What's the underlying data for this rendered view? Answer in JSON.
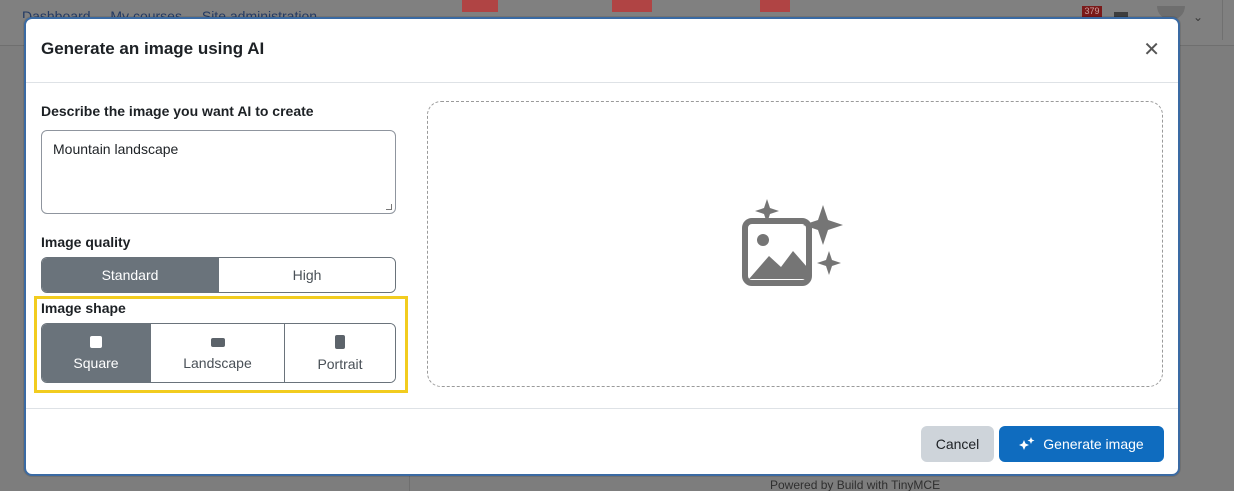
{
  "background": {
    "nav_items": [
      "Dashboard",
      "My courses",
      "Site administration"
    ],
    "notification_count": "379",
    "footer_text": "Powered by Build with TinyMCE"
  },
  "modal": {
    "title": "Generate an image using AI",
    "close_icon": "close-icon",
    "prompt": {
      "label": "Describe the image you want AI to create",
      "value": "Mountain landscape"
    },
    "quality": {
      "label": "Image quality",
      "options": [
        "Standard",
        "High"
      ],
      "selected": "Standard"
    },
    "shape": {
      "label": "Image shape",
      "options": [
        {
          "label": "Square",
          "icon": "square-icon"
        },
        {
          "label": "Landscape",
          "icon": "landscape-icon"
        },
        {
          "label": "Portrait",
          "icon": "portrait-icon"
        }
      ],
      "selected": "Square"
    },
    "preview": {
      "icon": "ai-image-placeholder-icon"
    },
    "footer": {
      "cancel_label": "Cancel",
      "generate_label": "Generate image",
      "generate_icon": "sparkle-icon"
    }
  },
  "colors": {
    "primary": "#0f6cbf",
    "segment_active": "#6a737b",
    "highlight": "#f2cc1f",
    "modal_border": "#3a6aa3"
  }
}
